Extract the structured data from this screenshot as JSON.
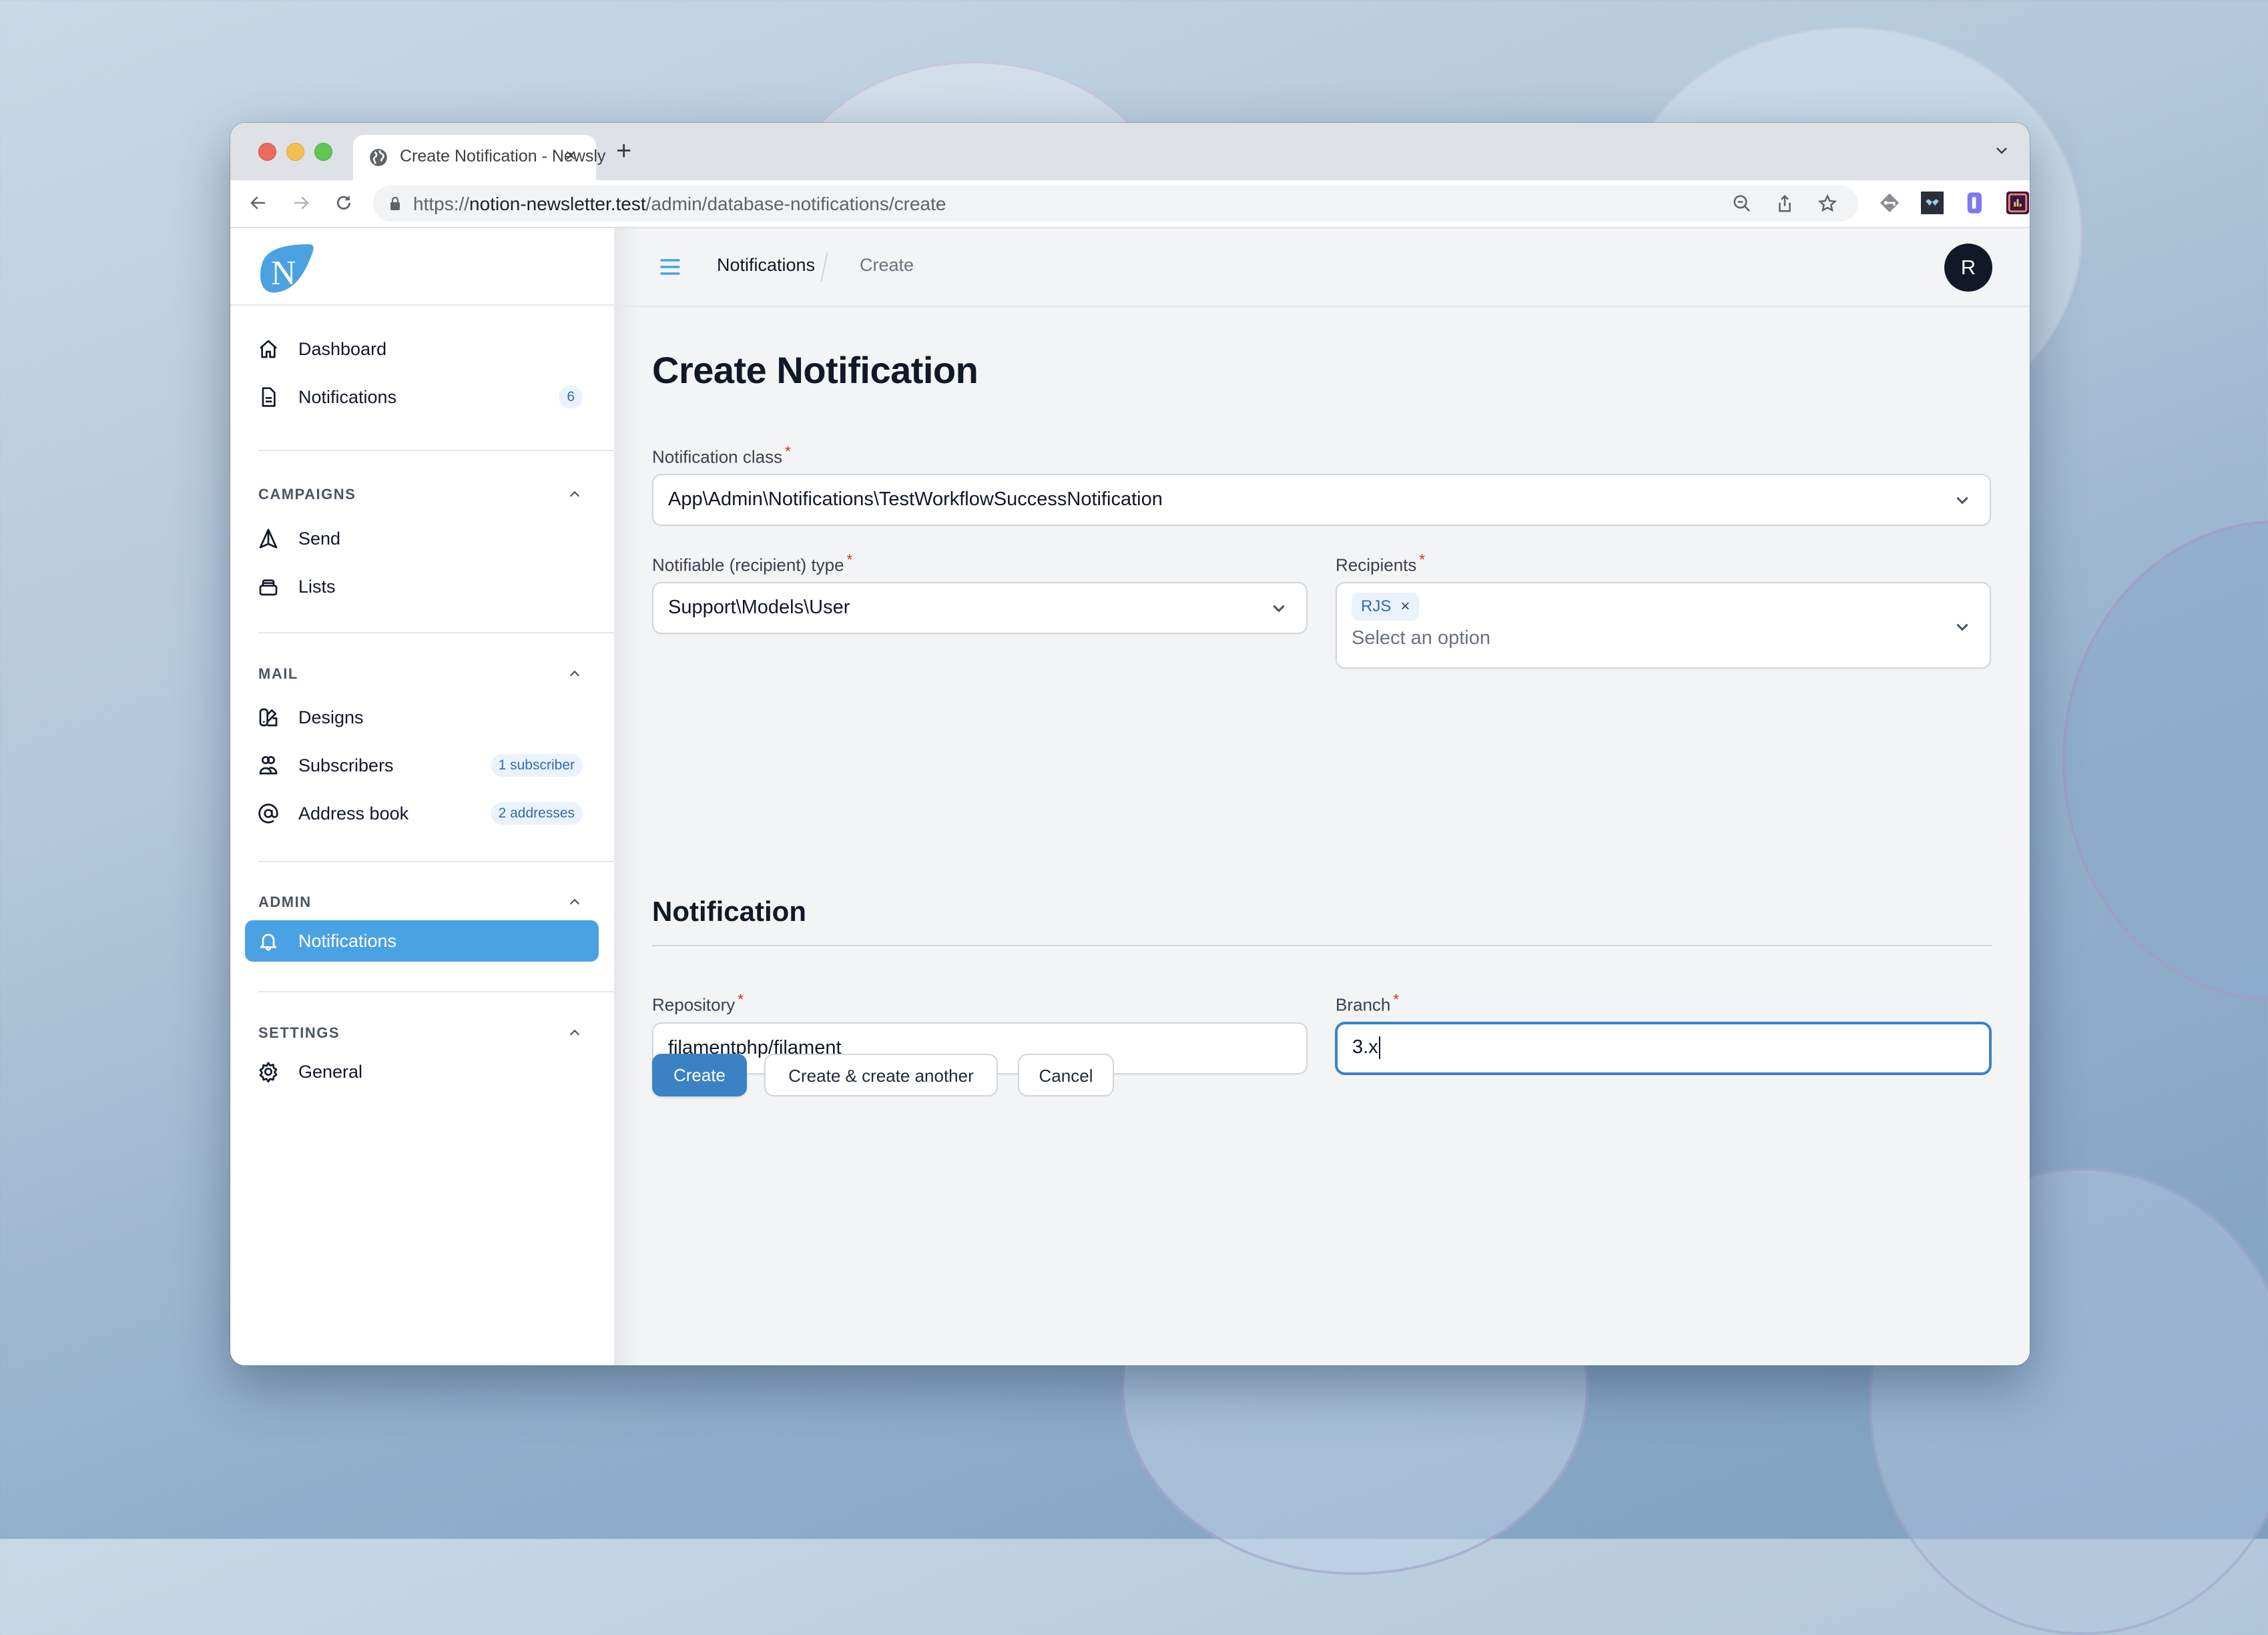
{
  "browser": {
    "tab_title": "Create Notification - Newsly",
    "tab_close": "×",
    "new_tab": "+",
    "url_scheme": "https://",
    "url_host": "notion-newsletter.test",
    "url_path": "/admin/database-notifications/create",
    "toolbar_icons": [
      "back-icon",
      "forward-icon",
      "reload-icon",
      "lock-icon",
      "zoom-out-icon",
      "share-icon",
      "bookmark-star-icon",
      "extension-icons",
      "puzzle-icon",
      "side-panel-icon",
      "profile-icon",
      "kebab-menu-icon"
    ]
  },
  "app": {
    "logo_letter": "N",
    "brand_color": "#4ba2e2",
    "primary_color": "#3b82c4"
  },
  "sidebar": {
    "top_items": [
      {
        "label": "Dashboard",
        "icon": "home-icon"
      },
      {
        "label": "Notifications",
        "icon": "document-icon",
        "badge": "6"
      }
    ],
    "groups": [
      {
        "label": "CAMPAIGNS",
        "items": [
          {
            "label": "Send",
            "icon": "paper-airplane-icon"
          },
          {
            "label": "Lists",
            "icon": "inbox-stack-icon"
          }
        ]
      },
      {
        "label": "MAIL",
        "items": [
          {
            "label": "Designs",
            "icon": "swatch-icon"
          },
          {
            "label": "Subscribers",
            "icon": "users-icon",
            "badge": "1 subscriber"
          },
          {
            "label": "Address book",
            "icon": "at-symbol-icon",
            "badge": "2 addresses"
          }
        ]
      },
      {
        "label": "ADMIN",
        "items": [
          {
            "label": "Notifications",
            "icon": "bell-icon",
            "active": true
          }
        ]
      },
      {
        "label": "SETTINGS",
        "items": [
          {
            "label": "General",
            "icon": "cog-icon"
          }
        ]
      }
    ]
  },
  "topbar": {
    "breadcrumb": [
      "Notifications",
      "Create"
    ],
    "avatar_initial": "R"
  },
  "form": {
    "title": "Create Notification",
    "notification_class": {
      "label": "Notification class",
      "required": "*",
      "value": "App\\Admin\\Notifications\\TestWorkflowSuccessNotification"
    },
    "notifiable_type": {
      "label": "Notifiable (recipient) type",
      "required": "*",
      "value": "Support\\Models\\User"
    },
    "recipients": {
      "label": "Recipients",
      "required": "*",
      "chips": [
        "RJS"
      ],
      "chip_remove": "×",
      "placeholder": "Select an option"
    },
    "section_title": "Notification",
    "repository": {
      "label": "Repository",
      "required": "*",
      "value": "filamentphp/filament"
    },
    "branch": {
      "label": "Branch",
      "required": "*",
      "value": "3.x"
    },
    "buttons": {
      "create": "Create",
      "create_another": "Create & create another",
      "cancel": "Cancel"
    }
  }
}
